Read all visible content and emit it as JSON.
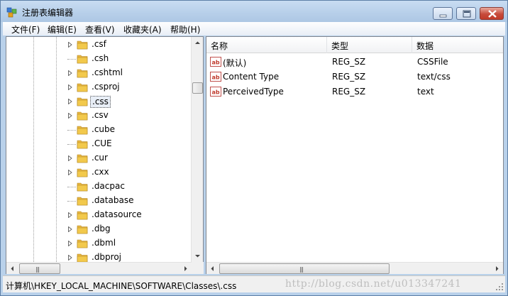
{
  "window": {
    "title": "注册表编辑器"
  },
  "menu": [
    "文件(F)",
    "编辑(E)",
    "查看(V)",
    "收藏夹(A)",
    "帮助(H)"
  ],
  "tree": {
    "items": [
      {
        "label": ".csf",
        "expandable": true
      },
      {
        "label": ".csh",
        "expandable": false
      },
      {
        "label": ".cshtml",
        "expandable": true
      },
      {
        "label": ".csproj",
        "expandable": true
      },
      {
        "label": ".css",
        "expandable": true,
        "selected": true
      },
      {
        "label": ".csv",
        "expandable": true
      },
      {
        "label": ".cube",
        "expandable": false
      },
      {
        "label": ".CUE",
        "expandable": false
      },
      {
        "label": ".cur",
        "expandable": true
      },
      {
        "label": ".cxx",
        "expandable": true
      },
      {
        "label": ".dacpac",
        "expandable": false
      },
      {
        "label": ".database",
        "expandable": false
      },
      {
        "label": ".datasource",
        "expandable": true
      },
      {
        "label": ".dbg",
        "expandable": true
      },
      {
        "label": ".dbml",
        "expandable": true
      },
      {
        "label": ".dbproj",
        "expandable": true
      }
    ]
  },
  "list": {
    "columns": [
      "名称",
      "类型",
      "数据"
    ],
    "rows": [
      {
        "name": "(默认)",
        "type": "REG_SZ",
        "data": "CSSFile"
      },
      {
        "name": "Content Type",
        "type": "REG_SZ",
        "data": "text/css"
      },
      {
        "name": "PerceivedType",
        "type": "REG_SZ",
        "data": "text"
      }
    ]
  },
  "status": {
    "path": "计算机\\HKEY_LOCAL_MACHINE\\SOFTWARE\\Classes\\.css",
    "watermark": "http://blog.csdn.net/u013347241"
  },
  "colors": {
    "titlebar": "#b9d1ea",
    "close": "#c74b3b",
    "folder": "#f2c94c"
  }
}
